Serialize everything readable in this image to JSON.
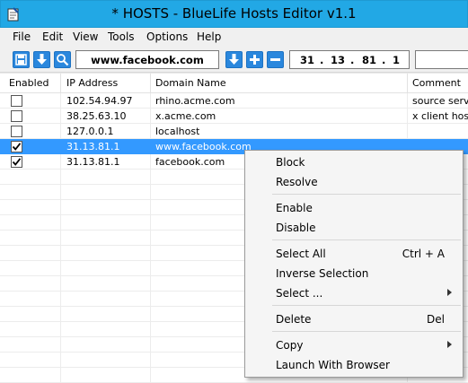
{
  "window": {
    "title": "* HOSTS - BlueLife Hosts Editor v1.1"
  },
  "menu": [
    "File",
    "Edit",
    "View",
    "Tools",
    "Options",
    "Help"
  ],
  "toolbar": {
    "domain_value": "www.facebook.com",
    "ip_parts": [
      "31",
      "13",
      "81",
      "1"
    ],
    "comment_value": ""
  },
  "columns": [
    "Enabled",
    "IP Address",
    "Domain Name",
    "Comment"
  ],
  "rows": [
    {
      "enabled": false,
      "ip": "102.54.94.97",
      "domain": "rhino.acme.com",
      "comment": "source server"
    },
    {
      "enabled": false,
      "ip": "38.25.63.10",
      "domain": "x.acme.com",
      "comment": "x client host"
    },
    {
      "enabled": false,
      "ip": "127.0.0.1",
      "domain": "localhost",
      "comment": ""
    },
    {
      "enabled": true,
      "ip": "31.13.81.1",
      "domain": "www.facebook.com",
      "comment": "",
      "selected": true
    },
    {
      "enabled": true,
      "ip": "31.13.81.1",
      "domain": "facebook.com",
      "comment": ""
    }
  ],
  "context_menu": {
    "block": "Block",
    "resolve": "Resolve",
    "enable": "Enable",
    "disable": "Disable",
    "select_all": "Select All",
    "select_all_shortcut": "Ctrl + A",
    "inverse_selection": "Inverse Selection",
    "select_sub": "Select ...",
    "delete": "Delete",
    "delete_shortcut": "Del",
    "copy": "Copy",
    "launch_browser": "Launch With Browser"
  },
  "colors": {
    "titlebar": "#22a8e5",
    "selection": "#3399ff",
    "toolbar_button": "#2a87dd"
  },
  "icons": [
    "notepad-icon",
    "save-icon",
    "download-icon",
    "search-icon",
    "arrow-down-icon",
    "add-icon",
    "remove-icon",
    "checkmark-icon",
    "submenu-arrow-icon"
  ]
}
